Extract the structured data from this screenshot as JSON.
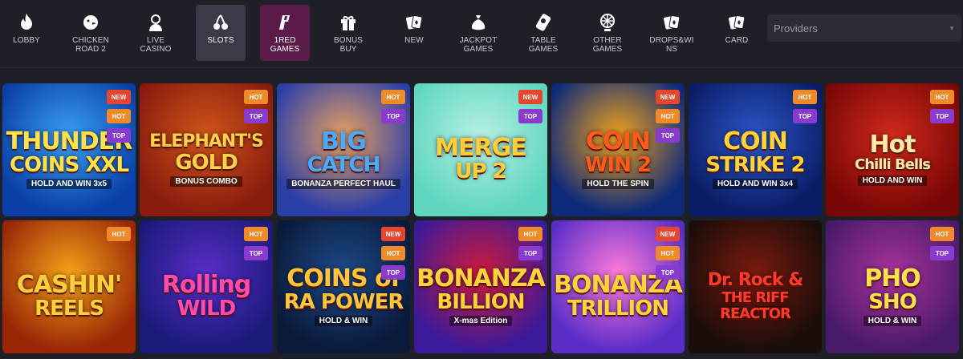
{
  "nav": {
    "items": [
      {
        "label": "LOBBY",
        "icon": "flame-icon"
      },
      {
        "label": "CHICKEN\nROAD 2",
        "icon": "chicken-icon"
      },
      {
        "label": "LIVE\nCASINO",
        "icon": "dealer-icon"
      },
      {
        "label": "SLOTS",
        "icon": "cherries-icon"
      },
      {
        "label": "1RED\nGAMES",
        "icon": "1red-logo-icon"
      },
      {
        "label": "BONUS\nBUY",
        "icon": "gift-icon"
      },
      {
        "label": "NEW",
        "icon": "cards-icon"
      },
      {
        "label": "JACKPOT\nGAMES",
        "icon": "money-bag-icon"
      },
      {
        "label": "TABLE\nGAMES",
        "icon": "roulette-table-icon"
      },
      {
        "label": "OTHER\nGAMES",
        "icon": "wheel-icon"
      },
      {
        "label": "DROPS&WI\nNS",
        "icon": "cards-icon"
      },
      {
        "label": "CARD",
        "icon": "cards-icon"
      }
    ],
    "providers_placeholder": "Providers"
  },
  "games": [
    {
      "l1": "THUNDER",
      "l2": "COINS XXL",
      "sub": "HOLD AND WIN 3x5",
      "badges": [
        "NEW",
        "HOT",
        "TOP"
      ],
      "bg1": "#0a3fa8",
      "bg2": "#3aa0f5",
      "c": "#ffe14a"
    },
    {
      "l1": "ELEPHANT'S",
      "l2": "GOLD",
      "sub": "BONUS COMBO",
      "badges": [
        "HOT",
        "TOP"
      ],
      "bg1": "#8a1b0e",
      "bg2": "#d1561a",
      "c": "#ffd04a"
    },
    {
      "l1": "BIG",
      "l2": "CATCH",
      "sub": "BONANZA PERFECT HAUL",
      "badges": [
        "HOT",
        "TOP"
      ],
      "bg1": "#2a3ea8",
      "bg2": "#e8a060",
      "c": "#4aa8ff"
    },
    {
      "l1": "MERGE",
      "l2": "UP 2",
      "sub": "",
      "badges": [
        "NEW",
        "TOP"
      ],
      "bg1": "#5fd6c0",
      "bg2": "#b7f0e3",
      "c": "#ffcf3a"
    },
    {
      "l1": "COIN",
      "l2": "WIN 2",
      "sub": "HOLD THE SPIN",
      "badges": [
        "NEW",
        "HOT",
        "TOP"
      ],
      "bg1": "#0d2a7a",
      "bg2": "#f2a21a",
      "c": "#ff5a1a"
    },
    {
      "l1": "COIN",
      "l2": "STRIKE 2",
      "sub": "HOLD AND WIN 3x4",
      "badges": [
        "HOT",
        "TOP"
      ],
      "bg1": "#0a1d66",
      "bg2": "#2c56c9",
      "c": "#ffd23a"
    },
    {
      "l1": "Hot",
      "l2": "Chilli Bells",
      "sub": "HOLD AND WIN",
      "badges": [
        "HOT",
        "TOP"
      ],
      "bg1": "#7a0707",
      "bg2": "#d12a1a",
      "c": "#ffe9a8"
    },
    {
      "l1": "CASHIN'",
      "l2": "REELS",
      "sub": "",
      "badges": [
        "HOT"
      ],
      "bg1": "#9a2606",
      "bg2": "#f5a21a",
      "c": "#ffcf3a"
    },
    {
      "l1": "Rolling",
      "l2": "WILD",
      "sub": "",
      "badges": [
        "HOT",
        "TOP"
      ],
      "bg1": "#1a1a7a",
      "bg2": "#5a2dc9",
      "c": "#ff4aa8"
    },
    {
      "l1": "COINS of",
      "l2": "RA POWER",
      "sub": "HOLD & WIN",
      "badges": [
        "NEW",
        "HOT",
        "TOP"
      ],
      "bg1": "#0a1a3a",
      "bg2": "#1d4a8a",
      "c": "#ffc43a"
    },
    {
      "l1": "BONANZA",
      "l2": "BILLION",
      "sub": "X-mas Edition",
      "badges": [
        "HOT",
        "TOP"
      ],
      "bg1": "#3a1a9a",
      "bg2": "#d11a3a",
      "c": "#ffd23a"
    },
    {
      "l1": "BONANZA",
      "l2": "TRILLION",
      "sub": "",
      "badges": [
        "NEW",
        "HOT",
        "TOP"
      ],
      "bg1": "#5a2dc9",
      "bg2": "#ff7ad9",
      "c": "#ffd23a"
    },
    {
      "l1": "Dr. Rock &",
      "l2": "THE RIFF REACTOR",
      "sub": "",
      "badges": [],
      "bg1": "#1a0d0a",
      "bg2": "#7a1a0e",
      "c": "#ff3a2a"
    },
    {
      "l1": "PHO",
      "l2": "SHO",
      "sub": "HOLD & WIN",
      "badges": [
        "HOT",
        "TOP"
      ],
      "bg1": "#4a1a6a",
      "bg2": "#a8329a",
      "c": "#ffe14a"
    }
  ]
}
